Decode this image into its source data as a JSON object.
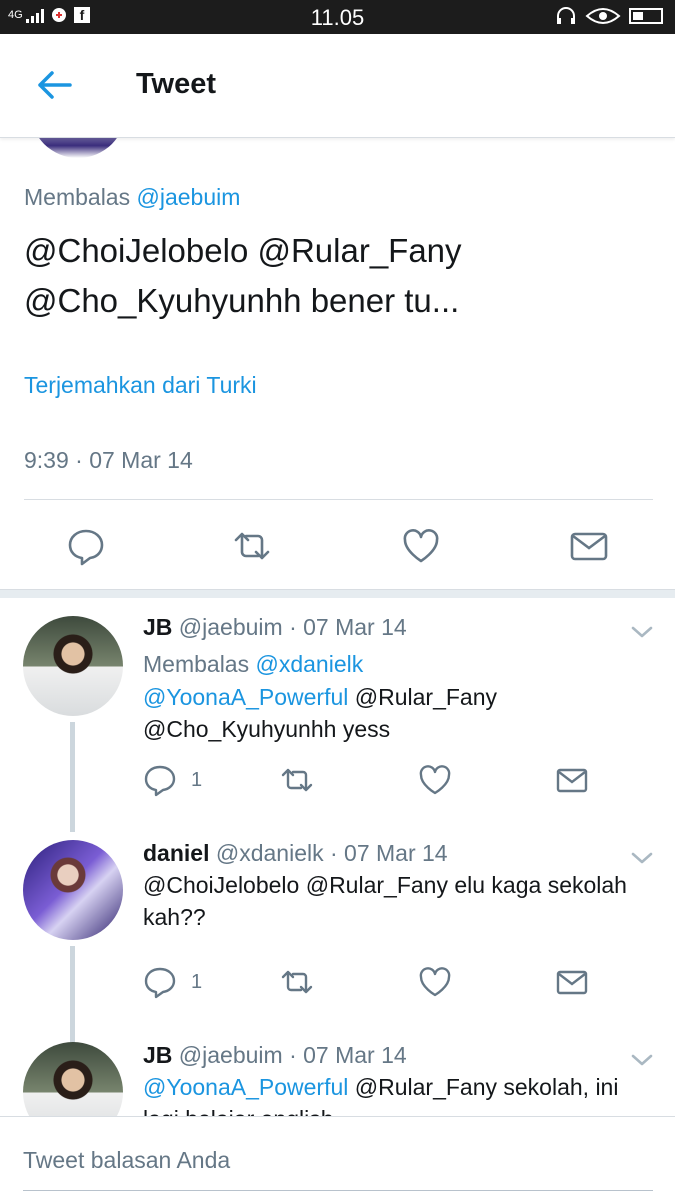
{
  "status_bar": {
    "time": "11.05",
    "network": "4G",
    "icons": [
      "signal-icon",
      "facebook-icon",
      "headset-icon",
      "eye-icon",
      "battery-icon"
    ]
  },
  "header": {
    "title": "Tweet",
    "back_icon": "back-arrow-icon"
  },
  "main_tweet": {
    "replying_prefix": "Membalas",
    "replying_to": "@jaebuim",
    "text_line1": "@ChoiJelobelo @Rular_Fany",
    "text_line2": "@Cho_Kyuhyunhh bener tu...",
    "translate": "Terjemahkan dari Turki",
    "timestamp": "9:39 · 07 Mar 14"
  },
  "replies": [
    {
      "name": "JB",
      "meta": "@jaebuim · 07 Mar 14",
      "replying_prefix": "Membalas",
      "replying_to": "@xdanielk",
      "line1_link": "@YoonaA_Powerful",
      "line1_rest": " @Rular_Fany",
      "line2": "@Cho_Kyuhyunhh yess",
      "reply_count": "1"
    },
    {
      "name": "daniel",
      "meta": "@xdanielk · 07 Mar 14",
      "line1": "@ChoiJelobelo @Rular_Fany elu kaga sekolah",
      "line2": "kah??",
      "reply_count": "1"
    },
    {
      "name": "JB",
      "meta": "@jaebuim · 07 Mar 14",
      "line1_link": "@YoonaA_Powerful",
      "line1_rest": " @Rular_Fany sekolah, ini",
      "line2": "lagi belajar english"
    }
  ],
  "compose": {
    "placeholder": "Tweet balasan Anda"
  },
  "colors": {
    "link": "#1b95e0",
    "muted": "#657786",
    "text": "#14171a",
    "divider": "#d8dde2"
  }
}
